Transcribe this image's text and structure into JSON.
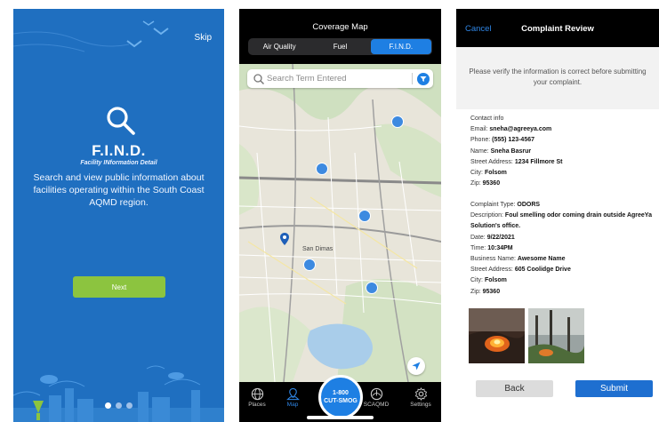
{
  "intro": {
    "skip_label": "Skip",
    "title": "F.I.N.D.",
    "subtitle": "Facility INformation Detail",
    "description": "Search and view public information about facilities operating within the South Coast AQMD region.",
    "next_label": "Next",
    "page_indicator": {
      "count": 3,
      "active_index": 0
    },
    "background_color": "#1f6fc0",
    "accent_color": "#8cc43f"
  },
  "map": {
    "title": "Coverage Map",
    "segments": [
      {
        "label": "Air Quality",
        "active": false
      },
      {
        "label": "Fuel",
        "active": false
      },
      {
        "label": "F.I.N.D.",
        "active": true
      }
    ],
    "search_placeholder": "Search Term Entered",
    "place_label": "San Dimas",
    "tabs": [
      {
        "label": "Places",
        "icon": "globe-icon",
        "active": false
      },
      {
        "label": "Map",
        "icon": "map-icon",
        "active": true
      },
      {
        "label": "SCAQMD",
        "icon": "scaqmd-logo-icon",
        "active": false
      },
      {
        "label": "Settings",
        "icon": "gear-icon",
        "active": false
      }
    ],
    "call_button": {
      "line1": "1-800",
      "line2": "CUT-SMOG"
    },
    "accent_color": "#1e7fe3"
  },
  "review": {
    "cancel_label": "Cancel",
    "title": "Complaint Review",
    "note": "Please verify the information is correct before submitting your complaint.",
    "contact": {
      "heading": "Contact info",
      "fields": [
        {
          "label": "Email:",
          "value": "sneha@agreeya.com"
        },
        {
          "label": "Phone:",
          "value": "(555) 123-4567"
        },
        {
          "label": "Name:",
          "value": "Sneha Basrur"
        },
        {
          "label": "Street Address:",
          "value": "1234 Fillmore St"
        },
        {
          "label": "City:",
          "value": "Folsom"
        },
        {
          "label": "Zip:",
          "value": "95360"
        }
      ]
    },
    "complaint": {
      "fields": [
        {
          "label": "Complaint Type:",
          "value": "ODORS"
        },
        {
          "label": "Description:",
          "value": "Foul smelling odor coming drain outside AgreeYa Solution's office."
        },
        {
          "label": "Date:",
          "value": "9/22/2021"
        },
        {
          "label": "Time:",
          "value": "10:34PM"
        },
        {
          "label": "Business Name:",
          "value": "Awesome Name"
        },
        {
          "label": "Street Address:",
          "value": "605 Coolidge Drive"
        },
        {
          "label": "City:",
          "value": "Folsom"
        },
        {
          "label": "Zip:",
          "value": "95360"
        }
      ]
    },
    "back_label": "Back",
    "submit_label": "Submit"
  }
}
